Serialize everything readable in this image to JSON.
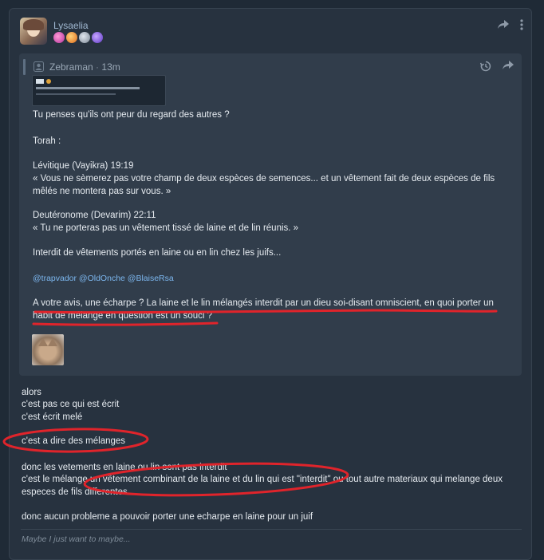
{
  "post": {
    "username": "Lysaelia",
    "badges": [
      "pink-badge-icon",
      "orange-badge-icon",
      "grey-badge-icon",
      "purple-badge-icon"
    ],
    "quote": {
      "author": "Zebraman",
      "time": "13m",
      "lines": [
        "Tu penses qu'ils ont peur du regard des autres ?",
        "Torah :",
        "Lévitique (Vayikra) 19:19",
        "« Vous ne sèmerez pas votre champ de deux espèces de semences... et un vêtement fait de deux espèces de fils",
        "mêlés ne montera pas sur vous. »",
        "Deutéronome (Devarim) 22:11",
        "« Tu ne porteras pas un vêtement tissé de laine et de lin réunis. »",
        "Interdit de vêtements portés en laine ou en lin chez les juifs...",
        "@trapvador @OldOnche @BlaiseRsa",
        "A votre avis, une écharpe ? La laine et le lin mélangés interdit par un dieu soi-disant omniscient, en quoi porter un",
        "habit de mélange en question est un souci ?"
      ]
    },
    "body_lines": [
      "alors",
      "c'est pas ce qui est écrit",
      "c'est écrit melé",
      "c'est a dire des mélanges",
      "donc les vetements en laine ou lin sont pas interdit",
      "c'est le mélange un vêtement combinant de la laine et du lin qui est \"interdit\" ou tout autre materiaux qui melange deux",
      "especes de fils differentes",
      "donc aucun probleme a pouvoir porter une echarpe en laine pour un juif"
    ],
    "signature": "Maybe I just want to maybe..."
  },
  "colors": {
    "annotation": "#e0242b",
    "mention": "#7cb7ef",
    "background": "#27323f"
  }
}
